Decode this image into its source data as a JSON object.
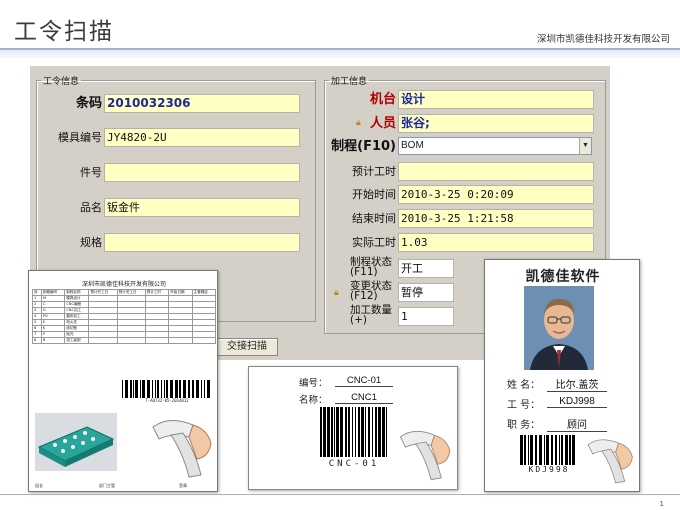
{
  "slide": {
    "title": "工令扫描",
    "company": "深圳市凯德佳科技开发有限公司",
    "page_number": "1"
  },
  "work_info": {
    "legend": "工令信息",
    "barcode_label": "条码",
    "barcode_value": "2010032306",
    "mould_no_label": "模具编号",
    "mould_no_value": "JY4820-2U",
    "part_no_label": "件号",
    "part_no_value": "",
    "part_name_label": "品名",
    "part_name_value": "钣金件",
    "spec_label": "规格",
    "spec_value": ""
  },
  "process_info": {
    "legend": "加工信息",
    "machine_label": "机台",
    "machine_value": "设计",
    "operator_label": "人员",
    "operator_value": "张谷;",
    "process_label": "制程(F10)",
    "process_value": "BOM",
    "planned_time_label": "预计工时",
    "planned_time_value": "",
    "start_time_label": "开始时间",
    "start_time_value": "2010-3-25 0:20:09",
    "end_time_label": "结束时间",
    "end_time_value": "2010-3-25 1:21:58",
    "actual_time_label": "实际工时",
    "actual_time_value": "1.03",
    "process_status_label": "制程状态(F11)",
    "process_status_value": "开工",
    "change_status_label": "变更状态(F12)",
    "change_status_value": "暂停",
    "quantity_label": "加工数量(+)",
    "quantity_value": "1"
  },
  "buttons": {
    "scan": "交接扫描"
  },
  "worksheet": {
    "title": "深圳市凯德佳科技开发有限公司",
    "barcode_text": "T-A0732-05-2014012",
    "columns": [
      "序",
      "制程编号",
      "制程名称",
      "预计开工日",
      "预计完工日",
      "预计工时",
      "开始日期",
      "主管确定"
    ],
    "steps": [
      {
        "no": "1",
        "code": "M",
        "name": "模具设计"
      },
      {
        "no": "2",
        "code": "C",
        "name": "CNC编程"
      },
      {
        "no": "3",
        "code": "G",
        "name": "CNC加工"
      },
      {
        "no": "4",
        "code": "PG",
        "name": "磨床加工"
      },
      {
        "no": "5",
        "code": "E",
        "name": "电火花"
      },
      {
        "no": "6",
        "code": "K",
        "name": "线切割"
      },
      {
        "no": "7",
        "code": "P",
        "name": "抛光"
      },
      {
        "no": "8",
        "code": "B",
        "name": "钳工装配"
      }
    ],
    "footer": [
      "组长",
      "部门主管",
      "签章"
    ]
  },
  "mould_card": {
    "number_label": "编号：",
    "number_value": "CNC-01",
    "name_label": "名称：",
    "name_value": "CNC1",
    "barcode_text": "CNC-01"
  },
  "staff_badge": {
    "title": "凯德佳软件",
    "name_label": "姓 名：",
    "name_value": "比尔.盖茨",
    "id_label": "工 号：",
    "id_value": "KDJ998",
    "role_label": "职 务：",
    "role_value": "顾问",
    "barcode_text": "KDJ998"
  },
  "colors": {
    "field_bg": "#ffffc4",
    "window_bg": "#d4d0c8",
    "label_red": "#b00000",
    "value_blue": "#1a2a9c",
    "header_band": "#9fb4cc"
  },
  "icons": {
    "lock": "lock-icon"
  }
}
